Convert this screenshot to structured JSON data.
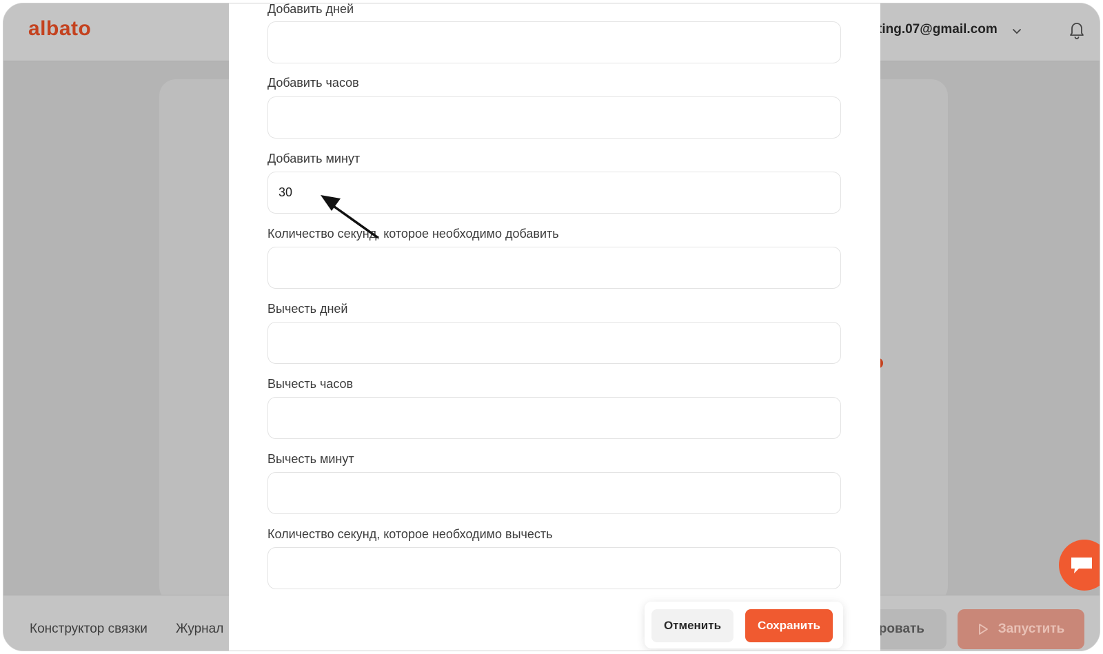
{
  "header": {
    "logo": "albato",
    "user_email": "ting.07@gmail.com"
  },
  "bottom_bar": {
    "constructor_label": "Конструктор связки",
    "journal_label": "Журнал",
    "test_label": "ровать",
    "launch_label": "Запустить"
  },
  "form": {
    "fields": [
      {
        "label": "Добавить дней",
        "value": ""
      },
      {
        "label": "Добавить часов",
        "value": ""
      },
      {
        "label": "Добавить минут",
        "value": "30"
      },
      {
        "label": "Количество секунд, которое необходимо добавить",
        "value": ""
      },
      {
        "label": "Вычесть дней",
        "value": ""
      },
      {
        "label": "Вычесть часов",
        "value": ""
      },
      {
        "label": "Вычесть минут",
        "value": ""
      },
      {
        "label": "Количество секунд, которое необходимо вычесть",
        "value": ""
      }
    ],
    "cancel_label": "Отменить",
    "save_label": "Сохранить"
  },
  "icons": {
    "chevron": "chevron-down-icon",
    "bell": "bell-icon",
    "play": "play-icon",
    "chat": "chat-icon",
    "arrow": "annotation-arrow"
  },
  "colors": {
    "accent": "#f05a30",
    "logo": "#c4421f",
    "overlay": "#b4b4b4"
  }
}
